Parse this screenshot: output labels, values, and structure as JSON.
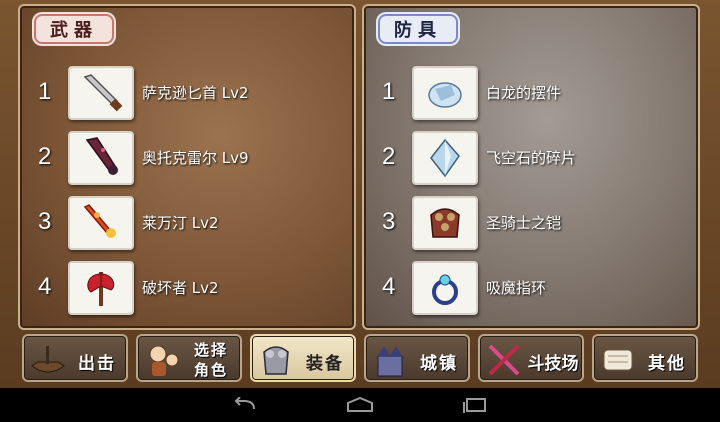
{
  "weapons": {
    "title": "武器",
    "items": [
      {
        "num": "1",
        "name": "萨克逊匕首 Lv2",
        "icon": "knife-icon"
      },
      {
        "num": "2",
        "name": "奥托克雷尔 Lv9",
        "icon": "dark-sword-icon"
      },
      {
        "num": "3",
        "name": "莱万汀 Lv2",
        "icon": "flame-sword-icon"
      },
      {
        "num": "4",
        "name": "破坏者 Lv2",
        "icon": "battle-axe-icon"
      }
    ]
  },
  "armor": {
    "title": "防具",
    "items": [
      {
        "num": "1",
        "name": "白龙的摆件",
        "icon": "dragon-ornament-icon"
      },
      {
        "num": "2",
        "name": "飞空石的碎片",
        "icon": "crystal-shard-icon"
      },
      {
        "num": "3",
        "name": "圣骑士之铠",
        "icon": "armor-icon"
      },
      {
        "num": "4",
        "name": "吸魔指环",
        "icon": "ring-icon"
      }
    ]
  },
  "nav": {
    "attack": "出击",
    "select_line1": "选择",
    "select_line2": "角色",
    "equip": "装备",
    "town": "城镇",
    "arena": "斗技场",
    "other": "其他"
  },
  "active_tab": "equip",
  "system": {
    "back": "back-icon",
    "home": "home-icon",
    "recents": "recents-icon"
  }
}
